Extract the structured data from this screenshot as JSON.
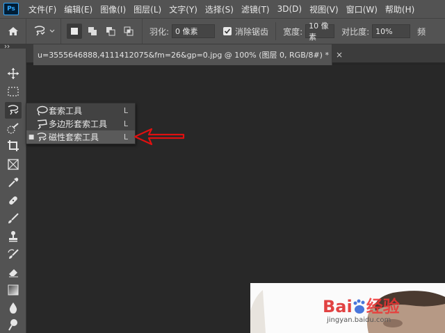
{
  "app": {
    "logo_text": "Ps"
  },
  "menu": [
    "文件(F)",
    "编辑(E)",
    "图像(I)",
    "图层(L)",
    "文字(Y)",
    "选择(S)",
    "滤镜(T)",
    "3D(D)",
    "视图(V)",
    "窗口(W)",
    "帮助(H)"
  ],
  "options": {
    "feather_label": "羽化:",
    "feather_value": "0 像素",
    "antialias_label": "消除锯齿",
    "width_label": "宽度:",
    "width_value": "10 像素",
    "contrast_label": "对比度:",
    "contrast_value": "10%",
    "frequency_label": "频"
  },
  "document": {
    "tab_title": "u=3555646888,4111412075&fm=26&gp=0.jpg @ 100% (图层 0, RGB/8#) *",
    "close_glyph": "×"
  },
  "flyout": {
    "items": [
      {
        "label": "套索工具",
        "shortcut": "L",
        "icon": "lasso-icon",
        "selected": false
      },
      {
        "label": "多边形套索工具",
        "shortcut": "L",
        "icon": "polygonal-lasso-icon",
        "selected": false
      },
      {
        "label": "磁性套索工具",
        "shortcut": "L",
        "icon": "magnetic-lasso-icon",
        "selected": true
      }
    ],
    "selected_marker": "■"
  },
  "annotation": {
    "arrow_color": "#e01010"
  },
  "watermark": {
    "brand_left": "Bai",
    "brand_right": "经验",
    "url": "jingyan.baidu.com"
  },
  "colors": {
    "panel": "#535353",
    "canvas": "#282828",
    "menu_text": "#e8e8e8"
  }
}
